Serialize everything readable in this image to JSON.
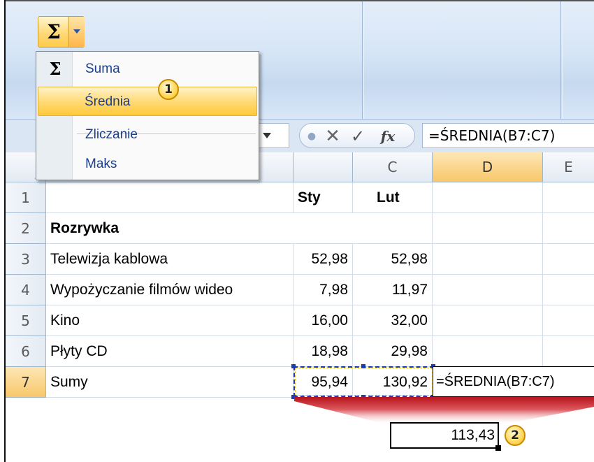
{
  "toolbar": {
    "autosum_icon": "sigma-icon",
    "autosum_symbol": "Σ"
  },
  "menu": {
    "items": [
      {
        "label": "Suma",
        "icon": "Σ"
      },
      {
        "label": "Średnia"
      },
      {
        "label": "Zliczanie"
      },
      {
        "label": "Maks"
      }
    ],
    "highlight_color": "#ffd86f"
  },
  "formula_bar": {
    "cancel": "✕",
    "enter": "✓",
    "fx": "fx",
    "formula": "=ŚREDNIA(B7:C7)"
  },
  "grid": {
    "columns": [
      "C",
      "D",
      "E"
    ],
    "selected_column": "D",
    "rows": [
      "1",
      "2",
      "3",
      "4",
      "5",
      "6",
      "7"
    ],
    "selected_row": "7",
    "header_row": {
      "b": "Sty",
      "c": "Lut"
    },
    "category": "Rozrywka",
    "data_rows": [
      {
        "label": "Telewizja kablowa",
        "b": "52,98",
        "c": "52,98"
      },
      {
        "label": "Wypożyczanie filmów wideo",
        "b": "7,98",
        "c": "11,97"
      },
      {
        "label": "Kino",
        "b": "16,00",
        "c": "32,00"
      },
      {
        "label": "Płyty CD",
        "b": "18,98",
        "c": "29,98"
      }
    ],
    "total_row": {
      "label": "Sumy",
      "b": "95,94",
      "c": "130,92",
      "edit_formula": "=ŚREDNIA(B7:C7)"
    }
  },
  "result": {
    "value": "113,43"
  },
  "badges": {
    "one": "1",
    "two": "2"
  },
  "colors": {
    "callout": "#c4141c",
    "selection": "#1d3cb0"
  }
}
